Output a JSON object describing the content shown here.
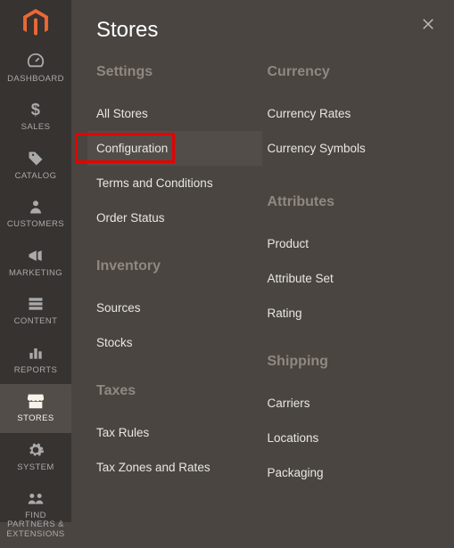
{
  "panel": {
    "title": "Stores"
  },
  "nav": [
    {
      "label": "DASHBOARD"
    },
    {
      "label": "SALES"
    },
    {
      "label": "CATALOG"
    },
    {
      "label": "CUSTOMERS"
    },
    {
      "label": "MARKETING"
    },
    {
      "label": "CONTENT"
    },
    {
      "label": "REPORTS"
    },
    {
      "label": "STORES"
    },
    {
      "label": "SYSTEM"
    },
    {
      "label": "FIND PARTNERS & EXTENSIONS"
    }
  ],
  "left_sections": [
    {
      "title": "Settings",
      "items": [
        "All Stores",
        "Configuration",
        "Terms and Conditions",
        "Order Status"
      ]
    },
    {
      "title": "Inventory",
      "items": [
        "Sources",
        "Stocks"
      ]
    },
    {
      "title": "Taxes",
      "items": [
        "Tax Rules",
        "Tax Zones and Rates"
      ]
    }
  ],
  "right_sections": [
    {
      "title": "Currency",
      "items": [
        "Currency Rates",
        "Currency Symbols"
      ]
    },
    {
      "title": "Attributes",
      "items": [
        "Product",
        "Attribute Set",
        "Rating"
      ]
    },
    {
      "title": "Shipping",
      "items": [
        "Carriers",
        "Locations",
        "Packaging"
      ]
    }
  ]
}
